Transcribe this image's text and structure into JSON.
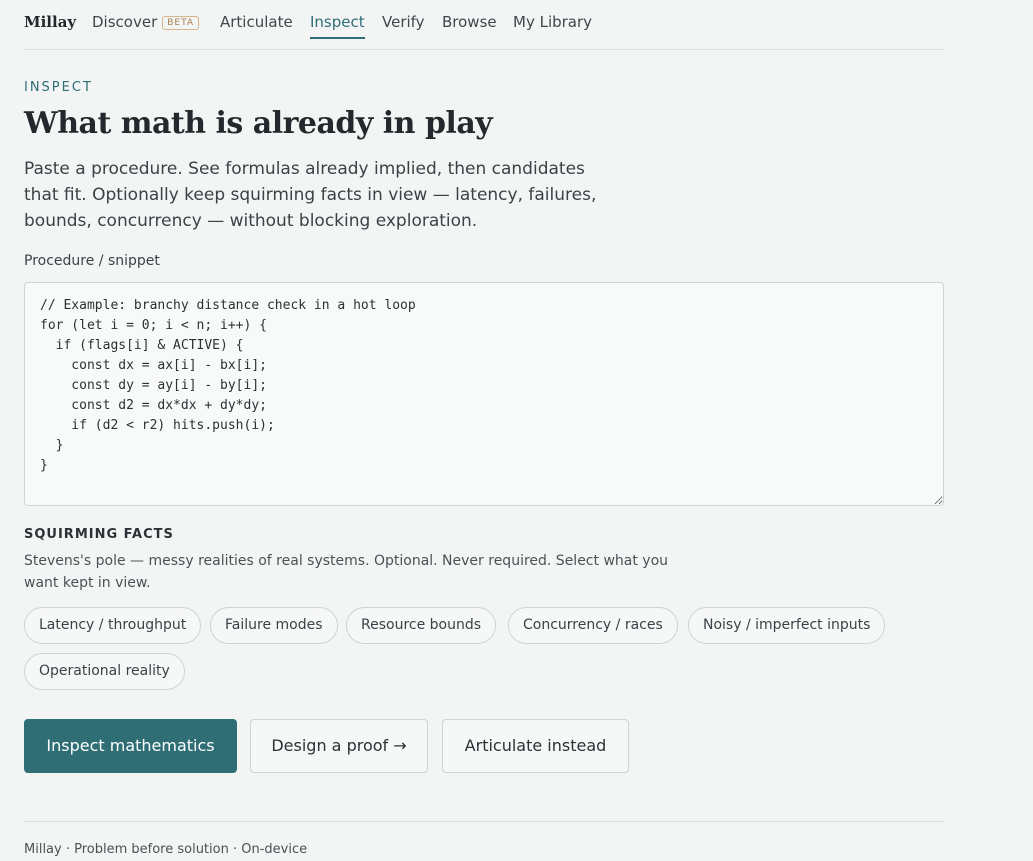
{
  "nav": {
    "brand": "Millay",
    "links": [
      "Discover",
      "Articulate",
      "Inspect",
      "Verify",
      "Browse",
      "My Library"
    ],
    "beta_badge": "BETA",
    "active": "Inspect",
    "accent_color": "#2e6e74"
  },
  "page": {
    "eyebrow": "INSPECT",
    "title": "What math is already in play",
    "lede": "Paste a procedure. See formulas already implied, then candidates that fit. Optionally keep squirming facts in view — latency, failures, bounds, concurrency — without blocking exploration."
  },
  "editor": {
    "label": "Procedure / snippet",
    "value": "// Example: branchy distance check in a hot loop\nfor (let i = 0; i < n; i++) {\n  if (flags[i] & ACTIVE) {\n    const dx = ax[i] - bx[i];\n    const dy = ay[i] - by[i];\n    const d2 = dx*dx + dy*dy;\n    if (d2 < r2) hits.push(i);\n  }\n}"
  },
  "squirming": {
    "title": "SQUIRMING FACTS",
    "description": "Stevens's pole — messy realities of real systems. Optional. Never required. Select what you want kept in view.",
    "chips": [
      "Latency / throughput",
      "Failure modes",
      "Resource bounds",
      "Concurrency / races",
      "Noisy / imperfect inputs",
      "Operational reality"
    ]
  },
  "actions": {
    "primary": "Inspect mathematics",
    "secondary": "Design a proof →",
    "tertiary": "Articulate instead"
  },
  "footer": {
    "text": "Millay · Problem before solution · On-device"
  }
}
